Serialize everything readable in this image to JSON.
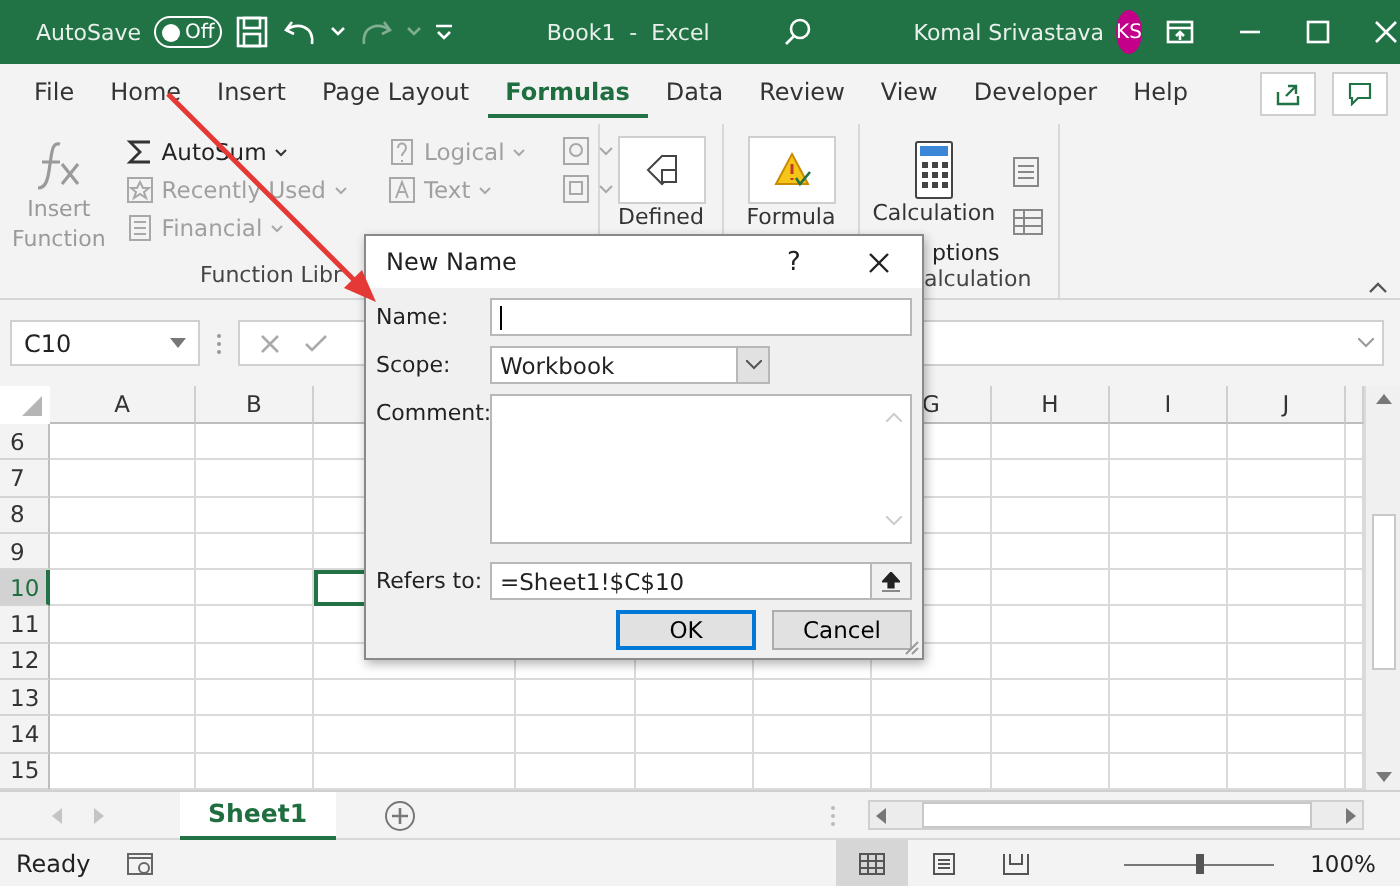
{
  "title_bar": {
    "autosave_label": "AutoSave",
    "autosave_toggle": {
      "label": "Off",
      "on": false
    },
    "quick_access": [
      {
        "kind": "save",
        "disabled": false
      },
      {
        "kind": "undo",
        "disabled": false
      },
      {
        "kind": "redo",
        "disabled": true
      }
    ],
    "document_title": "Book1  -  Excel",
    "user_name": "Komal Srivastava",
    "avatar_initials": "KS"
  },
  "tabs": [
    {
      "label": "File",
      "selected": false
    },
    {
      "label": "Home",
      "selected": false
    },
    {
      "label": "Insert",
      "selected": false
    },
    {
      "label": "Page Layout",
      "selected": false
    },
    {
      "label": "Formulas",
      "selected": true
    },
    {
      "label": "Data",
      "selected": false
    },
    {
      "label": "Review",
      "selected": false
    },
    {
      "label": "View",
      "selected": false
    },
    {
      "label": "Developer",
      "selected": false
    },
    {
      "label": "Help",
      "selected": false
    }
  ],
  "ribbon": {
    "function_library": {
      "group_label": "Function Libr",
      "insert_function": {
        "label_lines": [
          "Insert",
          "Function"
        ],
        "disabled": true
      },
      "commands": [
        {
          "label": "AutoSum",
          "disabled": false
        },
        {
          "label": "Recently Used",
          "disabled": true
        },
        {
          "label": "Financial",
          "disabled": true
        },
        {
          "label": "Logical",
          "disabled": true
        },
        {
          "label": "Text",
          "disabled": true
        }
      ]
    },
    "defined_names": {
      "label": "Defined"
    },
    "formula_auditing": {
      "label": "Formula"
    },
    "calculation": {
      "label": "Calculation",
      "label_rest": "ptions",
      "group_label": "alculation"
    }
  },
  "formula_bar": {
    "name_box": "C10"
  },
  "grid": {
    "columns": [
      "A",
      "B",
      "G",
      "H",
      "I",
      "J"
    ],
    "rows": [
      {
        "label": "6",
        "selected": false
      },
      {
        "label": "7",
        "selected": false
      },
      {
        "label": "8",
        "selected": false
      },
      {
        "label": "9",
        "selected": false
      },
      {
        "label": "10",
        "selected": true
      },
      {
        "label": "11",
        "selected": false
      },
      {
        "label": "12",
        "selected": false
      },
      {
        "label": "13",
        "selected": false
      },
      {
        "label": "14",
        "selected": false
      },
      {
        "label": "15",
        "selected": false
      }
    ]
  },
  "sheet_tabs": [
    {
      "label": "Sheet1",
      "selected": true
    }
  ],
  "status_bar": {
    "text": "Ready",
    "views": [
      {
        "kind": "normal",
        "selected": true
      },
      {
        "kind": "page_layout",
        "selected": false
      },
      {
        "kind": "page_break",
        "selected": false
      }
    ],
    "zoom_slider": {
      "level": 0.5
    },
    "zoom": "100%"
  },
  "dialog": {
    "title": "New Name",
    "help": "?",
    "fields": [
      {
        "kind": "text",
        "label": "Name:",
        "focused": true
      },
      {
        "kind": "select",
        "label": "Scope:",
        "value": "Workbook"
      },
      {
        "kind": "textarea",
        "label": "Comment:"
      },
      {
        "kind": "reference",
        "label": "Refers to:",
        "value": "=Sheet1!$C$10"
      }
    ],
    "buttons": [
      {
        "label": "OK",
        "default": true
      },
      {
        "label": "Cancel",
        "default": false
      }
    ]
  }
}
